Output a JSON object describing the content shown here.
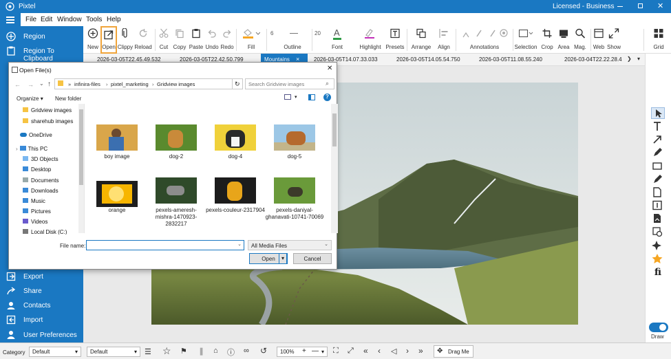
{
  "app": {
    "title": "Pixtel",
    "license": "Licensed - Business"
  },
  "menu": [
    "File",
    "Edit",
    "Window",
    "Tools",
    "Help"
  ],
  "ribbon": {
    "new": "New",
    "open": "Open",
    "clippy": "Clippy",
    "reload": "Reload",
    "cut": "Cut",
    "copy": "Copy",
    "paste": "Paste",
    "undo": "Undo",
    "redo": "Redo",
    "fill": "Fill",
    "outline": "Outline",
    "font": "Font",
    "highlight": "Highlight",
    "presets": "Presets",
    "arrange": "Arrange",
    "align": "Align",
    "annotations": "Annotations",
    "selection": "Selection",
    "crop": "Crop",
    "area": "Area",
    "mag": "Mag.",
    "web": "Web",
    "show": "Show",
    "grid": "Grid",
    "outline_size": "6",
    "font_size": "20"
  },
  "sidebar": {
    "top": [
      {
        "label": "Region",
        "icon": "region-icon"
      },
      {
        "label": "Region To Clipboard",
        "icon": "clipboard-icon"
      }
    ],
    "bottom": [
      {
        "label": "Export",
        "icon": "export-icon"
      },
      {
        "label": "Share",
        "icon": "share-icon"
      },
      {
        "label": "Contacts",
        "icon": "contacts-icon"
      },
      {
        "label": "Import",
        "icon": "import-icon"
      },
      {
        "label": "User Preferences",
        "icon": "preferences-icon"
      }
    ]
  },
  "tabs": [
    "2026-03-05T22.45.49.532",
    "2026-03-05T22.42.50.799",
    "Mountains",
    "2026-03-05T14.07.33.033",
    "2026-03-05T14.05.54.750",
    "2026-03-05T11.08.55.240",
    "2026-03-04T22.22.28.4"
  ],
  "dialog": {
    "title": "Open File(s)",
    "breadcrumb": [
      "infinira-files",
      "pixtel_marketing",
      "Gridview images"
    ],
    "search_placeholder": "Search Gridview images",
    "organize": "Organize",
    "new_folder": "New folder",
    "tree": [
      "Gridview images",
      "sharehub images",
      "OneDrive",
      "This PC",
      "3D Objects",
      "Desktop",
      "Documents",
      "Downloads",
      "Music",
      "Pictures",
      "Videos",
      "Local Disk (C:)"
    ],
    "files": [
      {
        "name": "boy image"
      },
      {
        "name": "dog-2"
      },
      {
        "name": "dog-4"
      },
      {
        "name": "dog-5"
      },
      {
        "name": "orange"
      },
      {
        "name": "pexels-ameresh-mishra-1470923-2832217"
      },
      {
        "name": "pexels-couleur-2317904"
      },
      {
        "name": "pexels-daniyal-ghanavati-10741-70069"
      }
    ],
    "file_name_label": "File name:",
    "file_name_value": "",
    "filter": "All Media Files",
    "open": "Open",
    "cancel": "Cancel"
  },
  "draw": {
    "label": "Draw",
    "on": true
  },
  "bottom": {
    "category_label": "Category",
    "category_value": "Default",
    "second_value": "Default",
    "zoom": "100%",
    "drag": "Drag Me"
  },
  "colors": {
    "accent": "#1a78c2",
    "open_highlight": "#f0a43a"
  }
}
